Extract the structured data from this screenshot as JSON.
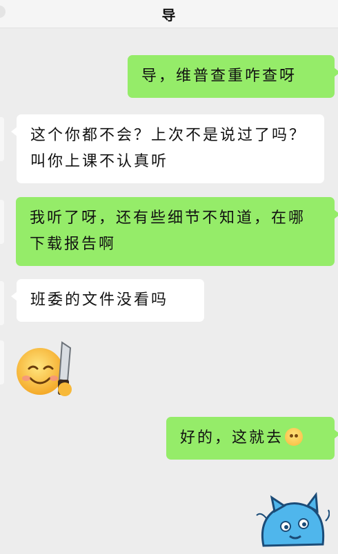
{
  "header": {
    "title": "导"
  },
  "messages": [
    {
      "side": "right",
      "text": "导，维普查重咋查呀"
    },
    {
      "side": "left",
      "text": "这个你都不会？上次不是说过了吗？叫你上课不认真听"
    },
    {
      "side": "right",
      "text": "我听了呀，还有些细节不知道，在哪下载报告啊"
    },
    {
      "side": "left",
      "text": "班委的文件没看吗"
    },
    {
      "side": "left",
      "sticker": "smiling-face-with-knife-sticker"
    },
    {
      "side": "right",
      "text": "好的，这就去",
      "trailing_icon": "crying-face-icon"
    }
  ],
  "bottom_sticker": "blue-cat-sticker",
  "colors": {
    "sent_bubble": "#95ec69",
    "received_bubble": "#ffffff",
    "background": "#ededed"
  }
}
